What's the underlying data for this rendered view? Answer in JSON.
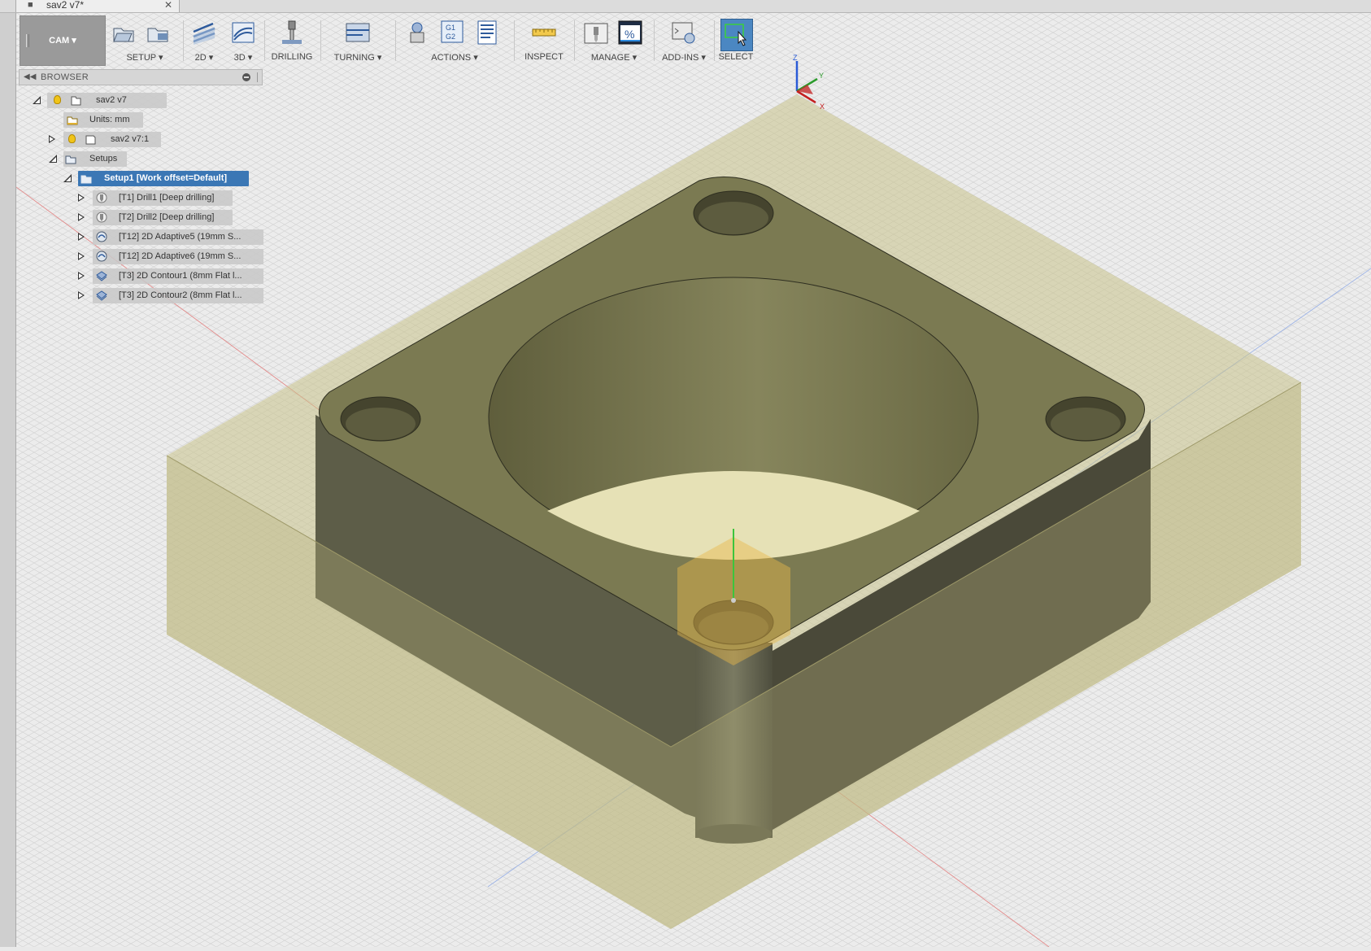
{
  "document_tab": {
    "title": "sav2 v7*",
    "close_glyph": "✕"
  },
  "toolbar": {
    "workspace": "CAM",
    "groups": [
      {
        "label": "SETUP ▾"
      },
      {
        "label": "2D ▾"
      },
      {
        "label": "3D ▾"
      },
      {
        "label": "DRILLING"
      },
      {
        "label": "TURNING ▾"
      },
      {
        "label": "ACTIONS ▾"
      },
      {
        "label": "INSPECT"
      },
      {
        "label": "MANAGE ▾"
      },
      {
        "label": "ADD-INS ▾"
      },
      {
        "label": "SELECT"
      }
    ],
    "gcode_icon_text": [
      "G1",
      "G2"
    ],
    "percent_icon_text": "%"
  },
  "browser": {
    "title": "BROWSER",
    "collapse_glyph": "◀◀",
    "root": {
      "label": "sav2 v7"
    },
    "units": {
      "label": "Units: mm"
    },
    "component": {
      "label": "sav2 v7:1"
    },
    "setups": {
      "label": "Setups"
    },
    "setup1": {
      "label": "Setup1 [Work offset=Default]"
    },
    "operations": [
      {
        "label": "[T1] Drill1 [Deep drilling]",
        "icon": "drill-icon"
      },
      {
        "label": "[T2] Drill2 [Deep drilling]",
        "icon": "drill-icon"
      },
      {
        "label": "[T12] 2D Adaptive5 (19mm S...",
        "icon": "adaptive-icon"
      },
      {
        "label": "[T12] 2D Adaptive6 (19mm S...",
        "icon": "adaptive-icon"
      },
      {
        "label": "[T3] 2D Contour1 (8mm Flat l...",
        "icon": "contour-icon"
      },
      {
        "label": "[T3] 2D Contour2 (8mm Flat l...",
        "icon": "contour-icon"
      }
    ]
  },
  "triad": {
    "x": "X",
    "y": "Y",
    "z": "Z"
  },
  "colors": {
    "accent_selected": "#3b77b5",
    "part_top": "#7b7a52",
    "stock": "#c8c27a",
    "grid_line": "#cfcfcf",
    "axis_red": "#e27a7a",
    "axis_blue": "#8aa7e0"
  }
}
